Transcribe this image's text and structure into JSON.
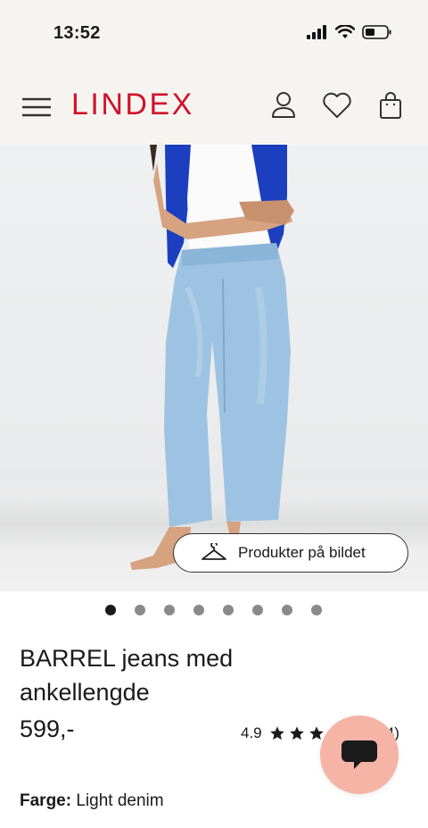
{
  "status_bar": {
    "time": "13:52"
  },
  "header": {
    "logo": "LINDEX"
  },
  "hero": {
    "products_button": "Produkter på bildet",
    "slide_count": 8,
    "active_slide": 1
  },
  "product": {
    "title": "BARREL jeans med ankellengde",
    "price": "599,-",
    "rating": "4.9",
    "stars": 5,
    "review_count": "(34)"
  },
  "color": {
    "label": "Farge:",
    "value": "Light denim"
  },
  "colors": {
    "brand": "#d1112c",
    "chat_bg": "#f5b4a6",
    "header_bg": "#f6f4f0"
  }
}
